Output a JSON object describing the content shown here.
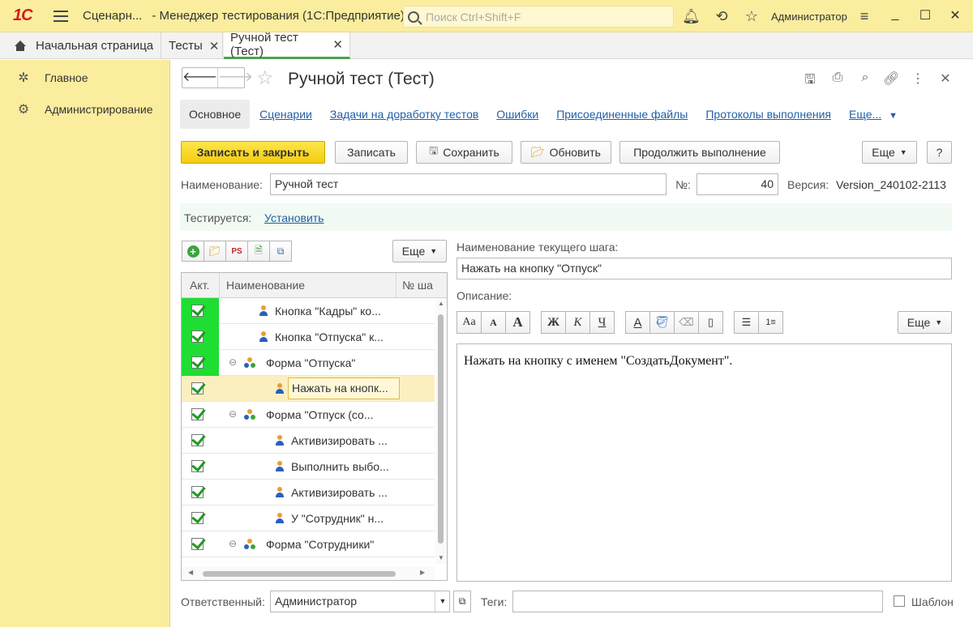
{
  "window": {
    "logo": "1С",
    "title_short": "Сценарн...",
    "title_app": "- Менеджер тестирования (1С:Предприятие)",
    "search_placeholder": "Поиск Ctrl+Shift+F",
    "user": "Администратор",
    "accent": "#fbed9e"
  },
  "tabs": [
    {
      "label": "Начальная страница",
      "closable": false
    },
    {
      "label": "Тесты",
      "closable": true
    },
    {
      "label": "Ручной тест (Тест)",
      "closable": true,
      "active": true
    }
  ],
  "sidebar": {
    "items": [
      {
        "label": "Главное",
        "icon": "bug-icon"
      },
      {
        "label": "Администрирование",
        "icon": "gear-icon"
      }
    ]
  },
  "form": {
    "title": "Ручной тест (Тест)",
    "tabs": [
      {
        "label": "Основное",
        "selected": true
      },
      {
        "label": "Сценарии"
      },
      {
        "label": "Задачи на доработку тестов"
      },
      {
        "label": "Ошибки"
      },
      {
        "label": "Присоединенные файлы"
      },
      {
        "label": "Протоколы выполнения"
      },
      {
        "label": "Еще..."
      }
    ],
    "buttons": {
      "save_close": "Записать и закрыть",
      "save": "Записать",
      "store": "Сохранить",
      "refresh": "Обновить",
      "continue": "Продолжить выполнение",
      "more": "Еще",
      "help": "?"
    },
    "name_label": "Наименование:",
    "name_value": "Ручной тест",
    "number_label": "№:",
    "number_value": "40",
    "version_label": "Версия:",
    "version_value": "Version_240102-2113",
    "tested_label": "Тестируется:",
    "tested_link": "Установить",
    "tree_more": "Еще",
    "tree": {
      "columns": [
        "Акт.",
        "Наименование",
        "№ ша"
      ],
      "rows": [
        {
          "active": true,
          "green": true,
          "type": "step",
          "indent": 1,
          "text": "Кнопка \"Кадры\" ко..."
        },
        {
          "active": true,
          "green": true,
          "type": "step",
          "indent": 1,
          "text": "Кнопка \"Отпуска\" к..."
        },
        {
          "active": true,
          "green": true,
          "type": "group",
          "indent": 0,
          "text": "Форма \"Отпуска\""
        },
        {
          "active": true,
          "green": false,
          "type": "step",
          "indent": 2,
          "text": "Нажать на кнопк...",
          "selected": true
        },
        {
          "active": true,
          "green": false,
          "type": "group",
          "indent": 0,
          "text": "Форма \"Отпуск (со..."
        },
        {
          "active": true,
          "green": false,
          "type": "step",
          "indent": 2,
          "text": "Активизировать ..."
        },
        {
          "active": true,
          "green": false,
          "type": "step",
          "indent": 2,
          "text": "Выполнить выбо..."
        },
        {
          "active": true,
          "green": false,
          "type": "step",
          "indent": 2,
          "text": "Активизировать ..."
        },
        {
          "active": true,
          "green": false,
          "type": "step",
          "indent": 2,
          "text": "У  \"Сотрудник\" н..."
        },
        {
          "active": true,
          "green": false,
          "type": "group",
          "indent": 0,
          "text": "Форма \"Сотрудники\""
        }
      ]
    },
    "step_name_label": "Наименование текущего шага:",
    "step_name_value": "Нажать на кнопку \"Отпуск\"",
    "description_label": "Описание:",
    "description_text": "Нажать на кнопку с именем \"СоздатьДокумент\".",
    "fmt_more": "Еще",
    "fmt": {
      "grow": "Aa",
      "shrink": "A",
      "big": "A",
      "bold": "Ж",
      "italic": "К",
      "underline": "Ч",
      "color": "A"
    },
    "responsible_label": "Ответственный:",
    "responsible_value": "Администратор",
    "tags_label": "Теги:",
    "template_label": "Шаблон"
  }
}
